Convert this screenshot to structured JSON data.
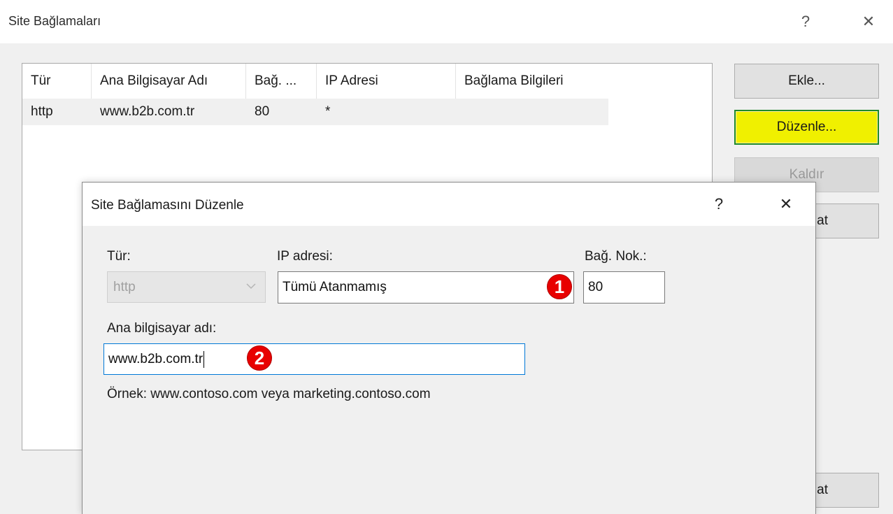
{
  "window": {
    "title": "Site Bağlamaları",
    "help": "?",
    "close": "✕"
  },
  "bindings_table": {
    "columns": [
      "Tür",
      "Ana Bilgisayar Adı",
      "Bağ. ...",
      "IP Adresi",
      "Bağlama Bilgileri"
    ],
    "rows": [
      [
        "http",
        "www.b2b.com.tr",
        "80",
        "*",
        ""
      ]
    ]
  },
  "buttons": {
    "add": "Ekle...",
    "edit": "Düzenle...",
    "remove": "Kaldır",
    "browse_partial": "at",
    "bottom_partial": "at"
  },
  "dialog": {
    "title": "Site Bağlamasını Düzenle",
    "help": "?",
    "close": "✕",
    "type_label": "Tür:",
    "type_value": "http",
    "ip_label": "IP adresi:",
    "ip_value": "Tümü Atanmamış",
    "port_label": "Bağ. Nok.:",
    "port_value": "80",
    "host_label": "Ana bilgisayar adı:",
    "host_value": "www.b2b.com.tr",
    "example_text": "Örnek: www.contoso.com veya marketing.contoso.com"
  },
  "annotations": {
    "marker_1": "1",
    "marker_2": "2"
  },
  "colors": {
    "highlight_button": "#f0f000",
    "highlight_border": "#1f8a2b",
    "marker_red": "#e80000",
    "focus_blue": "#0078d7"
  }
}
